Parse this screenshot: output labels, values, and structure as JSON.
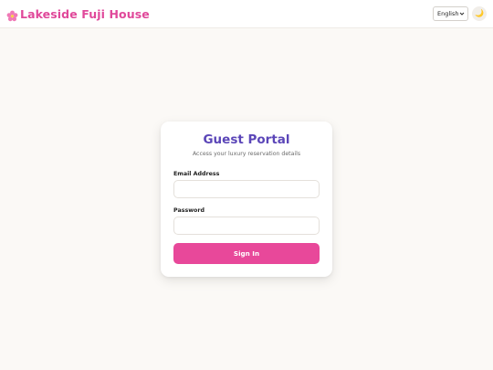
{
  "header": {
    "brand_icon": "cherry-blossom-icon",
    "title": "Lakeside Fuji House",
    "language": {
      "selected": "English"
    },
    "theme_toggle": {
      "icon": "moon-icon",
      "glyph": "🌙"
    }
  },
  "login": {
    "title": "Guest Portal",
    "subtitle": "Access your luxury reservation details",
    "email_label": "Email Address",
    "email_value": "",
    "password_label": "Password",
    "password_value": "",
    "submit_label": "Sign In"
  },
  "colors": {
    "brand": "#e0489a",
    "title": "#5b46b8",
    "button": "#e8489a",
    "background": "#fbf9f6"
  }
}
